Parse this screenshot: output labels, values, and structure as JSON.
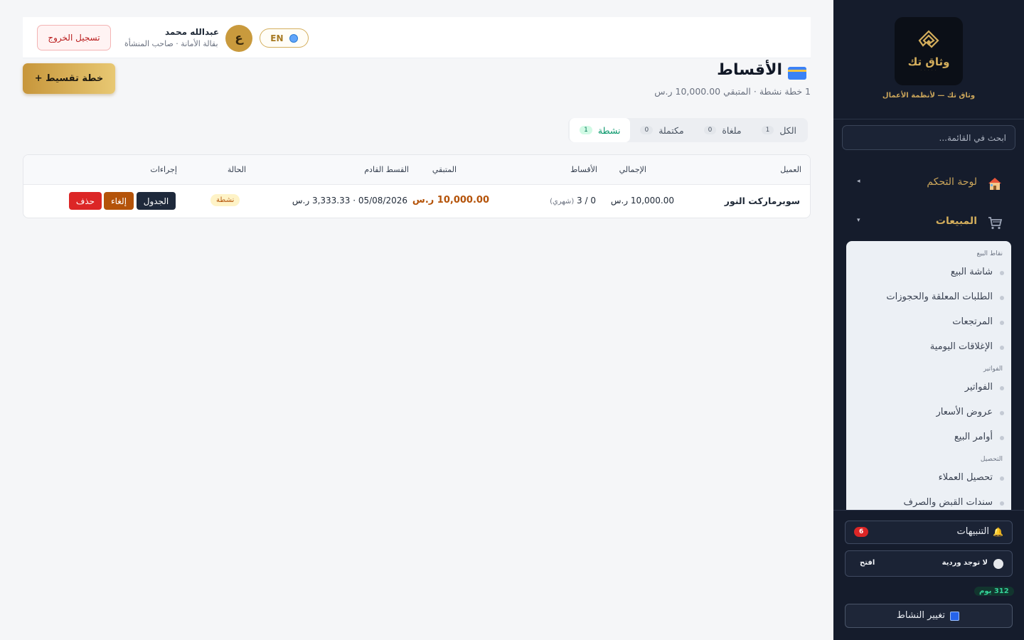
{
  "sidebar": {
    "brand_name": "وثاق تك",
    "brand_tagline": "وثاق تك — لأنظمة الأعمال",
    "search_placeholder": "ابحث في القائمة...",
    "nav_dashboard": "لوحة التحكم",
    "nav_sales": "المبيعات",
    "groups": {
      "pos": "نقاط البيع",
      "invoices": "الفواتير",
      "collection": "التحصيل"
    },
    "items": {
      "pos_screen": "شاشة البيع",
      "pending_orders": "الطلبات المعلقة والحجوزات",
      "returns": "المرتجعات",
      "daily_closings": "الإغلاقات اليومية",
      "invoices": "الفواتير",
      "quotes": "عروض الأسعار",
      "sales_orders": "أوامر البيع",
      "customer_collection": "تحصيل العملاء",
      "vouchers": "سندات القبض والصرف"
    },
    "alerts_label": "التنبيهات",
    "alerts_count": "6",
    "shift_label": "لا توجد وردية",
    "shift_open": "افتح",
    "days_badge": "312 يوم",
    "change_activity": "تغيير النشاط",
    "icons": [
      "house-icon",
      "cart-icon",
      "bell-icon",
      "refresh-icon"
    ]
  },
  "topbar": {
    "logout": "تسجيل الخروج",
    "user_name": "عبدالله محمد",
    "user_role": "بقالة الأمانة · صاحب المنشأة",
    "avatar_letter": "ع",
    "lang": "EN"
  },
  "page": {
    "title": "الأقساط",
    "subtitle": "1 خطة نشطة · المتبقي 10,000.00 ر.س",
    "add_button": "+ خطة تقسيط",
    "tabs": [
      {
        "label": "نشطة",
        "count": "1"
      },
      {
        "label": "مكتملة",
        "count": "0"
      },
      {
        "label": "ملغاة",
        "count": "0"
      },
      {
        "label": "الكل",
        "count": "1"
      }
    ]
  },
  "table": {
    "headers": {
      "client": "العميل",
      "total": "الإجمالي",
      "installments": "الأقساط",
      "remaining": "المتبقي",
      "next": "القسط القادم",
      "status": "الحالة",
      "actions": "إجراءات"
    },
    "rows": [
      {
        "client": "سوبرماركت النور",
        "total": "10,000.00 ر.س",
        "installments": "0 / 3",
        "frequency": "(شهري)",
        "remaining": "10,000.00 ر.س",
        "next": "05/08/2026 · 3,333.33 ر.س",
        "status": "نشطة",
        "btn_schedule": "الجدول",
        "btn_cancel": "إلغاء",
        "btn_delete": "حذف"
      }
    ]
  },
  "colors": {
    "gold": "#c9a45a",
    "sidebar_bg": "#151c2c",
    "active_green": "#059669",
    "danger": "#dc2626"
  }
}
